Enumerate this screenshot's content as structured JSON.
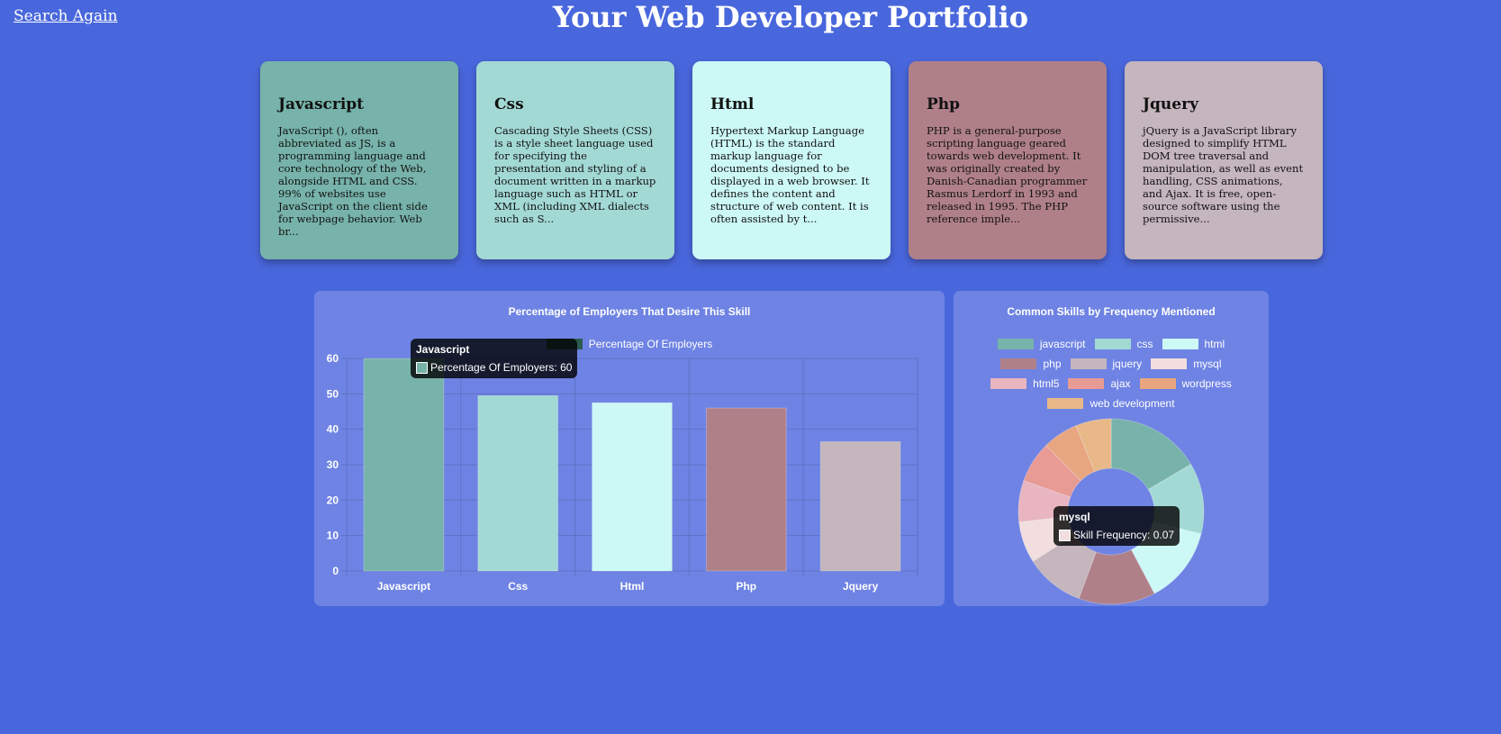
{
  "nav": {
    "search_again": "Search Again"
  },
  "header": {
    "title": "Your Web Developer Portfolio"
  },
  "cards": [
    {
      "title": "Javascript",
      "color": "#77b3aa",
      "text": "JavaScript (), often abbreviated as JS, is a programming language and core technology of the Web, alongside HTML and CSS. 99% of websites use JavaScript on the client side for webpage behavior. Web br..."
    },
    {
      "title": "Css",
      "color": "#a3d9d5",
      "text": "Cascading Style Sheets (CSS) is a style sheet language used for specifying the presentation and styling of a document written in a markup language such as HTML or XML (including XML dialects such as S..."
    },
    {
      "title": "Html",
      "color": "#ccf8f6",
      "text": "Hypertext Markup Language (HTML) is the standard markup language for documents designed to be displayed in a web browser. It defines the content and structure of web content. It is often assisted by t..."
    },
    {
      "title": "Php",
      "color": "#b08089",
      "text": "PHP is a general-purpose scripting language geared towards web development. It was originally created by Danish-Canadian programmer Rasmus Lerdorf in 1993 and released in 1995. The PHP reference imple..."
    },
    {
      "title": "Jquery",
      "color": "#c5b5bd",
      "text": "jQuery is a JavaScript library designed to simplify HTML DOM tree traversal and manipulation, as well as event handling, CSS animations, and Ajax. It is free, open-source software using the permissive..."
    }
  ],
  "chart_data": [
    {
      "type": "bar",
      "title": "Percentage of Employers That Desire This Skill",
      "categories": [
        "Javascript",
        "Css",
        "Html",
        "Php",
        "Jquery"
      ],
      "series": [
        {
          "name": "Percentage Of Employers",
          "values": [
            60,
            49.5,
            47.5,
            46,
            36.5
          ]
        }
      ],
      "colors": [
        "#77b3aa",
        "#a3d9d5",
        "#ccf8f6",
        "#b08089",
        "#c5b5bd"
      ],
      "ylim": [
        0,
        60
      ],
      "yticks": [
        0,
        10,
        20,
        30,
        40,
        50,
        60
      ],
      "grid": true,
      "legend": "top",
      "tooltip": {
        "title": "Javascript",
        "label": "Percentage Of Employers: 60",
        "color": "#77b3aa"
      }
    },
    {
      "type": "pie",
      "title": "Common Skills by Frequency Mentioned",
      "labels": [
        "javascript",
        "css",
        "html",
        "php",
        "jquery",
        "mysql",
        "html5",
        "ajax",
        "wordpress",
        "web development"
      ],
      "values": [
        0.16,
        0.12,
        0.13,
        0.13,
        0.1,
        0.07,
        0.07,
        0.07,
        0.06,
        0.06
      ],
      "colors": [
        "#77b3aa",
        "#a3d9d5",
        "#ccf8f6",
        "#b08089",
        "#c5b5bd",
        "#f2dede",
        "#e8b5c0",
        "#e89a94",
        "#e8a680",
        "#e8b888"
      ],
      "legend": "top",
      "tooltip": {
        "title": "mysql",
        "label": "Skill Frequency: 0.07",
        "color": "#f2dede"
      }
    }
  ]
}
